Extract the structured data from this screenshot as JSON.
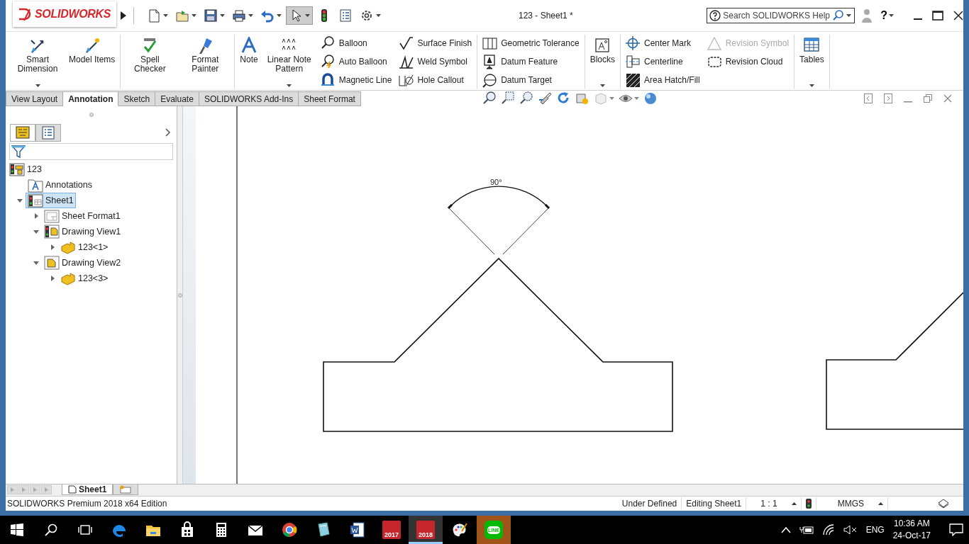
{
  "window": {
    "title": "123 - Sheet1 *",
    "logo": "SOLIDWORKS",
    "search": {
      "placeholder": "Search SOLIDWORKS Help"
    },
    "help": "?"
  },
  "quick_access": [
    {
      "selected": false
    },
    {
      "selected": false
    },
    {
      "selected": false
    },
    {
      "selected": false
    },
    {
      "selected": false
    },
    {
      "selected": true
    },
    {
      "selected": false
    },
    {
      "selected": false
    },
    {
      "selected": false
    }
  ],
  "ribbon": {
    "groups": [
      {
        "controls": [
          {
            "kind": "large",
            "label": "Smart Dimension",
            "dropdown": true
          },
          {
            "kind": "large",
            "label": "Model Items",
            "dropdown": false
          }
        ]
      },
      {
        "controls": [
          {
            "kind": "large",
            "label": "Spell Checker",
            "dropdown": false
          },
          {
            "kind": "large",
            "label": "Format Painter",
            "dropdown": false
          }
        ]
      },
      {
        "controls": [
          {
            "kind": "large",
            "label": "Note",
            "dropdown": false
          },
          {
            "kind": "large",
            "label": "Linear Note Pattern",
            "dropdown": true
          },
          {
            "kind": "stack",
            "items": [
              {
                "label": "Balloon",
                "disabled": false
              },
              {
                "label": "Auto Balloon",
                "disabled": false
              },
              {
                "label": "Magnetic Line",
                "disabled": false
              }
            ]
          },
          {
            "kind": "stack",
            "items": [
              {
                "label": "Surface Finish",
                "disabled": false
              },
              {
                "label": "Weld Symbol",
                "disabled": false
              },
              {
                "label": "Hole Callout",
                "disabled": false
              }
            ]
          }
        ]
      },
      {
        "controls": [
          {
            "kind": "stack",
            "items": [
              {
                "label": "Geometric Tolerance",
                "disabled": false
              },
              {
                "label": "Datum Feature",
                "disabled": false
              },
              {
                "label": "Datum Target",
                "disabled": false
              }
            ]
          }
        ]
      },
      {
        "controls": [
          {
            "kind": "large",
            "label": "Blocks",
            "dropdown": true
          }
        ]
      },
      {
        "controls": [
          {
            "kind": "stack",
            "items": [
              {
                "label": "Center Mark",
                "disabled": false
              },
              {
                "label": "Centerline",
                "disabled": false
              },
              {
                "label": "Area Hatch/Fill",
                "disabled": false
              }
            ]
          },
          {
            "kind": "stack",
            "items": [
              {
                "label": "Revision Symbol",
                "disabled": true
              },
              {
                "label": "Revision Cloud",
                "disabled": false
              }
            ]
          }
        ]
      },
      {
        "controls": [
          {
            "kind": "large",
            "label": "Tables",
            "dropdown": true
          }
        ]
      }
    ]
  },
  "tabs": [
    {
      "label": "View Layout",
      "selected": false
    },
    {
      "label": "Annotation",
      "selected": true
    },
    {
      "label": "Sketch",
      "selected": false
    },
    {
      "label": "Evaluate",
      "selected": false
    },
    {
      "label": "SOLIDWORKS Add-Ins",
      "selected": false
    },
    {
      "label": "Sheet Format",
      "selected": false
    }
  ],
  "feature_tree": {
    "tabs": [
      {
        "selected": true
      },
      {
        "selected": false
      }
    ],
    "items": [
      {
        "label": "123",
        "kind": "drawing",
        "selected": false,
        "children": [
          {
            "label": "Annotations",
            "kind": "annotations",
            "selected": false
          },
          {
            "label": "Sheet1",
            "kind": "sheet",
            "expanded": true,
            "selected": true,
            "children": [
              {
                "label": "Sheet Format1",
                "kind": "sheet-format",
                "expanded": false,
                "selected": false
              },
              {
                "label": "Drawing View1",
                "kind": "view",
                "expanded": true,
                "selected": false,
                "children": [
                  {
                    "label": "123<1>",
                    "kind": "part",
                    "expanded": false,
                    "selected": false
                  }
                ]
              },
              {
                "label": "Drawing View2",
                "kind": "view2",
                "expanded": true,
                "selected": false,
                "children": [
                  {
                    "label": "123<3>",
                    "kind": "part",
                    "expanded": false,
                    "selected": false
                  }
                ]
              }
            ]
          }
        ]
      }
    ]
  },
  "drawing": {
    "angle_dimension": "90°"
  },
  "sheet_tabs": [
    {
      "label": "Sheet1",
      "selected": true
    }
  ],
  "status_bar": {
    "edition": "SOLIDWORKS Premium 2018 x64 Edition",
    "state": "Under Defined",
    "mode": "Editing Sheet1",
    "scale": "1 : 1",
    "units": "MMGS"
  },
  "taskbar": {
    "apps": [
      {
        "kind": "edge",
        "selected": false,
        "flashing": false
      },
      {
        "kind": "explorer",
        "selected": false,
        "flashing": false
      },
      {
        "kind": "store",
        "selected": false,
        "flashing": false
      },
      {
        "kind": "calculator",
        "selected": false,
        "flashing": false
      },
      {
        "kind": "mail",
        "selected": false,
        "flashing": false
      },
      {
        "kind": "chrome",
        "selected": false,
        "flashing": false
      },
      {
        "kind": "notes",
        "selected": false,
        "flashing": false
      },
      {
        "kind": "word",
        "selected": false,
        "flashing": false
      },
      {
        "kind": "sw",
        "label": "2017",
        "selected": false,
        "flashing": false
      },
      {
        "kind": "sw",
        "label": "2018",
        "selected": true,
        "flashing": false
      },
      {
        "kind": "paint",
        "selected": false,
        "flashing": false
      },
      {
        "kind": "line",
        "label": "LINE",
        "selected": false,
        "flashing": true
      }
    ],
    "language": "ENG",
    "time": "10:36 AM",
    "date": "24-Oct-17"
  }
}
